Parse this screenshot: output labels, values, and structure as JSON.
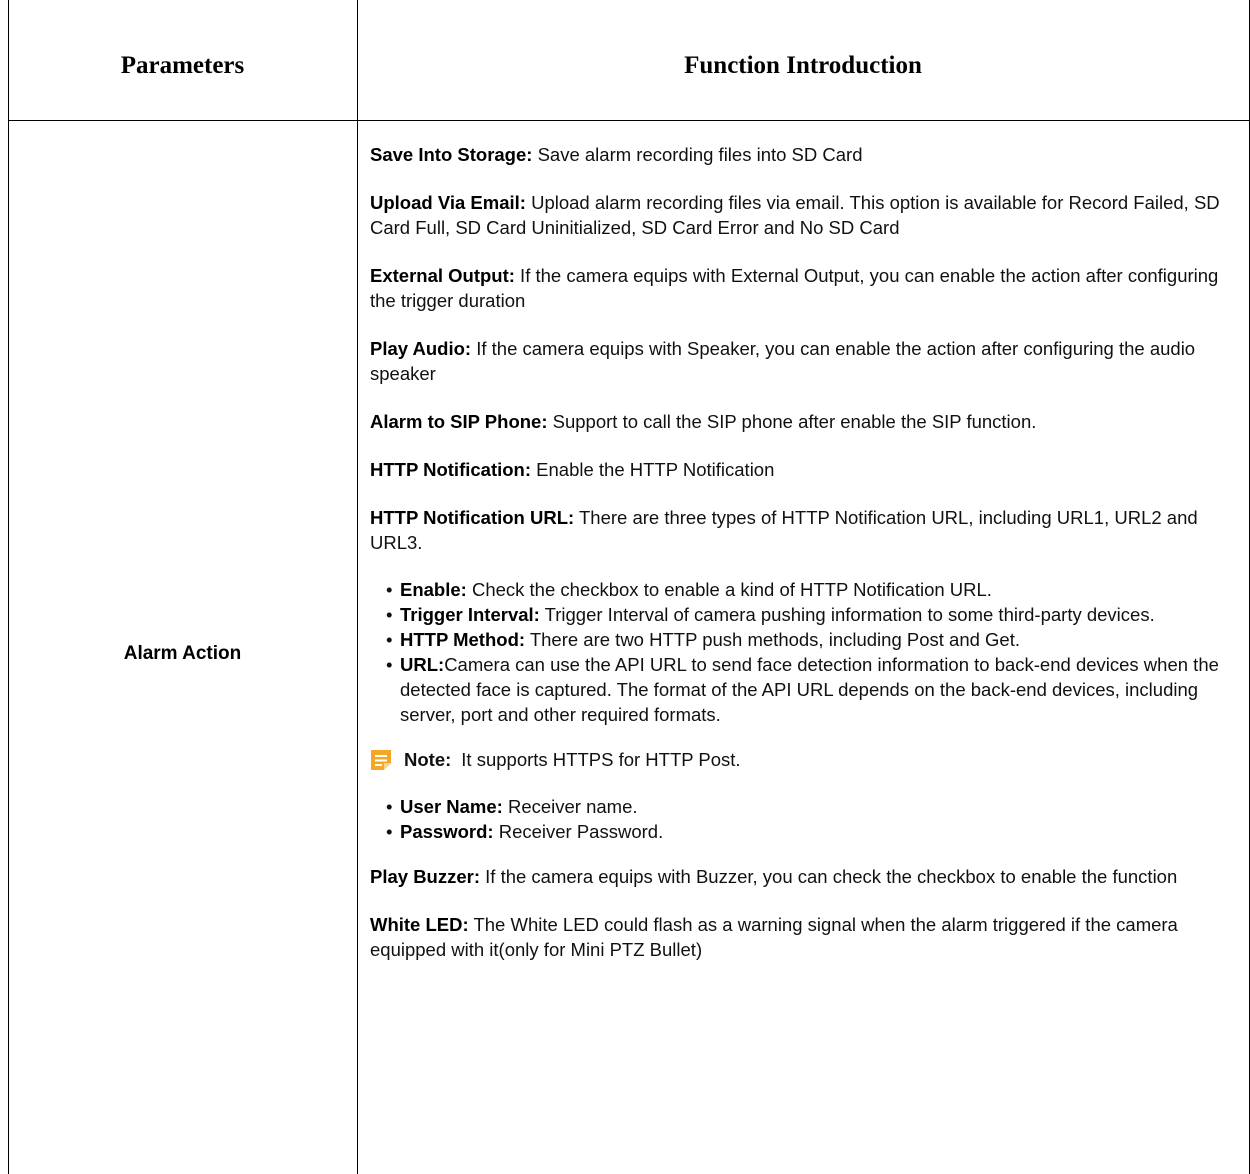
{
  "header": {
    "col1": "Parameters",
    "col2": "Function Introduction"
  },
  "row": {
    "param": "Alarm Action",
    "paragraphs_top": [
      {
        "label": "Save Into Storage:",
        "text": " Save alarm recording files into SD Card"
      },
      {
        "label": "Upload Via Email:",
        "text": " Upload alarm recording files via email. This option is available for Record Failed, SD Card Full, SD Card Uninitialized, SD Card Error and No SD Card"
      },
      {
        "label": "External Output:",
        "text": " If the camera equips with External Output, you can enable the action after configuring the trigger duration"
      },
      {
        "label": "Play Audio:",
        "text": " If the camera equips with Speaker, you can enable the action after configuring the audio speaker"
      },
      {
        "label": "Alarm to SIP Phone:",
        "text": " Support to call the SIP phone after enable the SIP function."
      },
      {
        "label": "HTTP Notification:",
        "text": " Enable the HTTP Notification"
      },
      {
        "label": "HTTP Notification URL:",
        "text": " There are three types of HTTP Notification URL, including URL1, URL2 and URL3."
      }
    ],
    "url_items": [
      {
        "label": "Enable:",
        "text": " Check the checkbox to enable a kind of HTTP Notification URL."
      },
      {
        "label": "Trigger Interval:",
        "text": " Trigger Interval of camera pushing information to some third-party devices."
      },
      {
        "label": "HTTP Method:",
        "text": " There are two HTTP push methods, including Post and Get."
      },
      {
        "label": "URL:",
        "text": "Camera can use the API URL to send face detection information to back-end devices when the detected face is captured. The format of the API URL depends on the back-end devices, including server, port and other required formats."
      }
    ],
    "note": {
      "icon": "note-icon",
      "label": "Note:",
      "text": "It supports HTTPS for HTTP Post."
    },
    "user_items": [
      {
        "label": "User Name:",
        "text": " Receiver name."
      },
      {
        "label": "Password:",
        "text": " Receiver Password."
      }
    ],
    "paragraphs_bottom": [
      {
        "label": "Play Buzzer:",
        "text": " If the camera equips with Buzzer, you can check the checkbox to enable the function"
      },
      {
        "label": "White LED:",
        "text": " The White LED could flash as a warning signal when the alarm triggered if the camera equipped with it(only for Mini PTZ Bullet)"
      }
    ]
  },
  "colors": {
    "border": "#000000",
    "note_icon_fill": "#f5a623",
    "note_icon_lines": "#ffffff"
  }
}
